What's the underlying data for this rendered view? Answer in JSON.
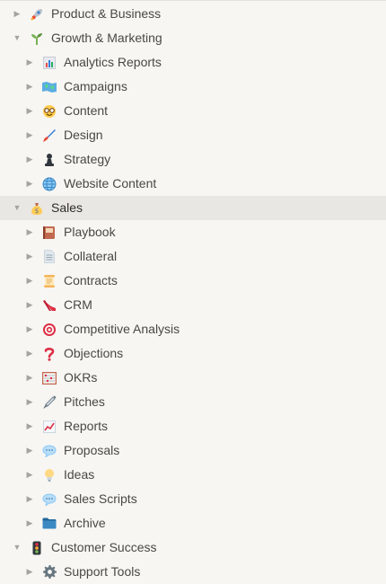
{
  "tree": [
    {
      "label": "Product & Business",
      "icon": "rocket-icon",
      "expanded": false
    },
    {
      "label": "Growth & Marketing",
      "icon": "seedling-icon",
      "expanded": true
    },
    {
      "label": "Analytics Reports",
      "icon": "bar-chart-icon"
    },
    {
      "label": "Campaigns",
      "icon": "map-icon"
    },
    {
      "label": "Content",
      "icon": "nerd-face-icon"
    },
    {
      "label": "Design",
      "icon": "paintbrush-icon"
    },
    {
      "label": "Strategy",
      "icon": "chess-pawn-icon"
    },
    {
      "label": "Website Content",
      "icon": "globe-icon"
    },
    {
      "label": "Sales",
      "icon": "money-bag-icon",
      "expanded": true,
      "active": true
    },
    {
      "label": "Playbook",
      "icon": "notebook-icon"
    },
    {
      "label": "Collateral",
      "icon": "document-icon"
    },
    {
      "label": "Contracts",
      "icon": "scroll-icon"
    },
    {
      "label": "CRM",
      "icon": "running-shoe-icon"
    },
    {
      "label": "Competitive Analysis",
      "icon": "target-icon"
    },
    {
      "label": "Objections",
      "icon": "question-mark-icon"
    },
    {
      "label": "OKRs",
      "icon": "abacus-icon"
    },
    {
      "label": "Pitches",
      "icon": "syringe-icon"
    },
    {
      "label": "Reports",
      "icon": "chart-increasing-icon"
    },
    {
      "label": "Proposals",
      "icon": "speech-bubble-icon"
    },
    {
      "label": "Ideas",
      "icon": "light-bulb-icon"
    },
    {
      "label": "Sales Scripts",
      "icon": "speech-bubble-icon"
    },
    {
      "label": "Archive",
      "icon": "folder-icon"
    },
    {
      "label": "Customer Success",
      "icon": "traffic-light-icon",
      "expanded": true
    },
    {
      "label": "Support Tools",
      "icon": "gear-icon"
    }
  ]
}
